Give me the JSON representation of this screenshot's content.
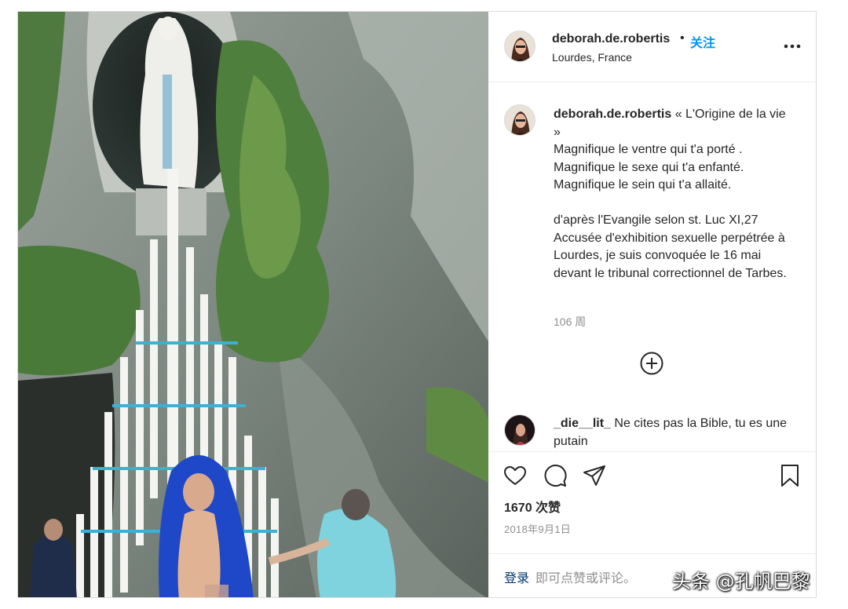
{
  "header": {
    "username": "deborah.de.robertis",
    "separator": "•",
    "follow_label": "关注",
    "location": "Lourdes, France",
    "more_icon": "more-options-icon"
  },
  "caption": {
    "username": "deborah.de.robertis",
    "text": " « L'Origine de la vie »\nMagnifique le ventre qui t'a porté .\nMagnifique le sexe qui t'a enfanté.\nMagnifique le sein qui t'a allaité.\n\nd'après l'Evangile selon st. Luc XI,27\nAccusée d'exhibition sexuelle perpétrée à Lourdes, je suis convoquée le 16 mai devant le tribunal correctionnel de Tarbes.",
    "age": "106 周"
  },
  "load_more_icon": "plus-circle-icon",
  "comment": {
    "username": "_die__lit_",
    "text": " Ne cites pas la Bible, tu es une putain"
  },
  "actions": {
    "icons": [
      "heart-icon",
      "comment-icon",
      "share-icon",
      "bookmark-icon"
    ],
    "likes": "1670 次赞",
    "date": "2018年9月1日"
  },
  "login": {
    "link": "登录",
    "rest": " 即可点赞或评论。"
  },
  "watermark": "头条 @孔帆巴黎",
  "colors": {
    "link_blue": "#0095f6",
    "secondary": "#8e8e8e",
    "text": "#262626",
    "border": "#dbdbdb"
  }
}
